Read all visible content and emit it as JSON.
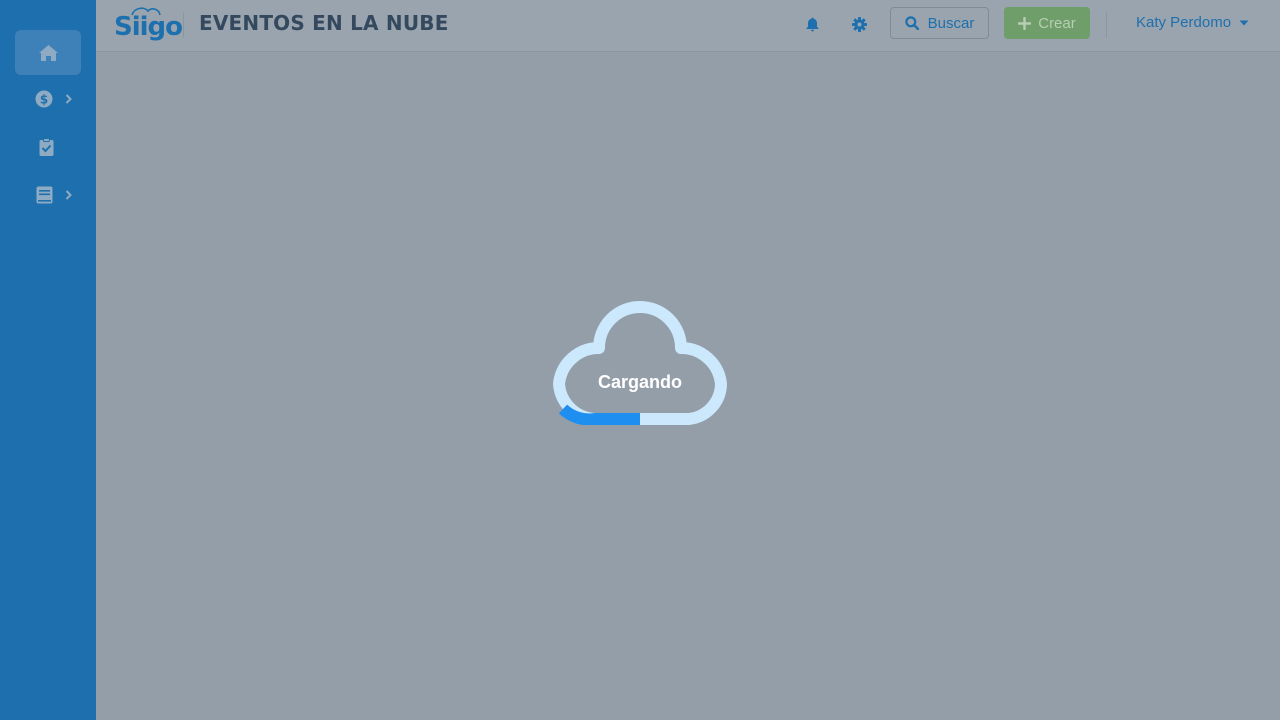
{
  "header": {
    "logo": "Siigo",
    "title": "EVENTOS EN LA NUBE",
    "search_label": "Buscar",
    "create_label": "Crear",
    "user_name": "Katy Perdomo"
  },
  "sidebar": {
    "items": [
      {
        "icon": "home-icon",
        "active": true
      },
      {
        "icon": "dollar-icon",
        "has_submenu": true
      },
      {
        "icon": "clipboard-check-icon"
      },
      {
        "icon": "book-icon",
        "has_submenu": true
      }
    ]
  },
  "loader": {
    "text": "Cargando",
    "progress_percent": 25
  },
  "colors": {
    "sidebar": "#1d70ad",
    "overlay": "#949ea8",
    "accent": "#1d70ad",
    "create": "#6f9e6a",
    "loader_track": "#cce8fc",
    "loader_progress": "#1e8ff0"
  }
}
